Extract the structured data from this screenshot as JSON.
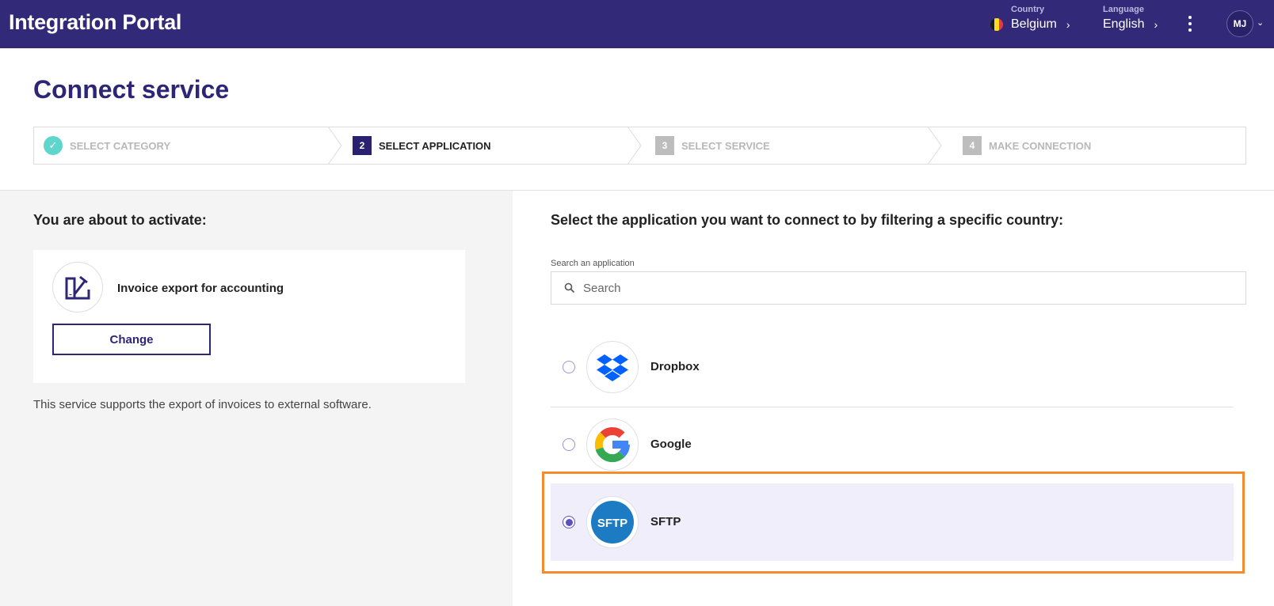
{
  "topbar": {
    "title": "Integration Portal",
    "country_caption": "Country",
    "country_value": "Belgium",
    "language_caption": "Language",
    "language_value": "English",
    "user_initials": "MJ",
    "bg_color": "#322a78"
  },
  "page": {
    "title": "Connect service"
  },
  "stepper": {
    "steps": [
      {
        "number": "",
        "label": "Select category",
        "state": "done"
      },
      {
        "number": "2",
        "label": "Select application",
        "state": "active"
      },
      {
        "number": "3",
        "label": "Select service",
        "state": "todo"
      },
      {
        "number": "4",
        "label": "Make connection",
        "state": "todo"
      }
    ]
  },
  "left": {
    "heading": "You are about to activate:",
    "service_name": "Invoice export for accounting",
    "change_label": "Change",
    "description": "This service supports the export of invoices to external software."
  },
  "right": {
    "heading": "Select the application you want to connect to by filtering a specific country:",
    "search_label": "Search an application",
    "search_placeholder": "Search",
    "search_value": "",
    "apps": [
      {
        "name": "Dropbox",
        "logo": "dropbox-logo",
        "selected": false
      },
      {
        "name": "Google",
        "logo": "google-logo",
        "selected": false
      },
      {
        "name": "SFTP",
        "logo": "sftp-logo",
        "selected": true
      }
    ],
    "highlight_color": "#f58a2e"
  }
}
